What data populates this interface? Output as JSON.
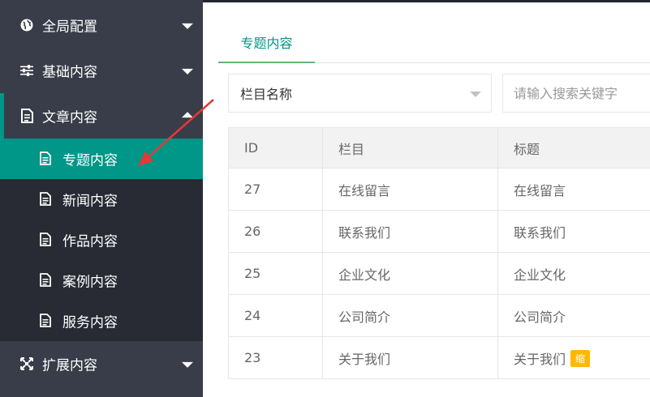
{
  "sidebar": {
    "items": [
      {
        "label": "全局配置",
        "icon": "globe-icon"
      },
      {
        "label": "基础内容",
        "icon": "sliders-icon"
      },
      {
        "label": "文章内容",
        "icon": "document-icon"
      },
      {
        "label": "扩展内容",
        "icon": "expand-icon"
      }
    ],
    "submenu": [
      {
        "label": "专题内容",
        "icon": "file-icon",
        "active": true
      },
      {
        "label": "新闻内容",
        "icon": "file-icon"
      },
      {
        "label": "作品内容",
        "icon": "file-icon"
      },
      {
        "label": "案例内容",
        "icon": "file-icon"
      },
      {
        "label": "服务内容",
        "icon": "file-icon"
      }
    ]
  },
  "main": {
    "tab_label": "专题内容",
    "filter": {
      "select_value": "栏目名称",
      "search_placeholder": "请输入搜索关键字"
    },
    "table": {
      "headers": [
        "ID",
        "栏目",
        "标题"
      ],
      "rows": [
        {
          "id": "27",
          "column": "在线留言",
          "title": "在线留言"
        },
        {
          "id": "26",
          "column": "联系我们",
          "title": "联系我们"
        },
        {
          "id": "25",
          "column": "企业文化",
          "title": "企业文化"
        },
        {
          "id": "24",
          "column": "公司简介",
          "title": "公司简介"
        },
        {
          "id": "23",
          "column": "关于我们",
          "title": "关于我们",
          "badge": "缩"
        }
      ]
    }
  },
  "colors": {
    "sidebar_bg": "#393d49",
    "submenu_bg": "#282b33",
    "accent": "#009688",
    "badge": "#ffb800",
    "annotation_arrow": "#e53935"
  }
}
